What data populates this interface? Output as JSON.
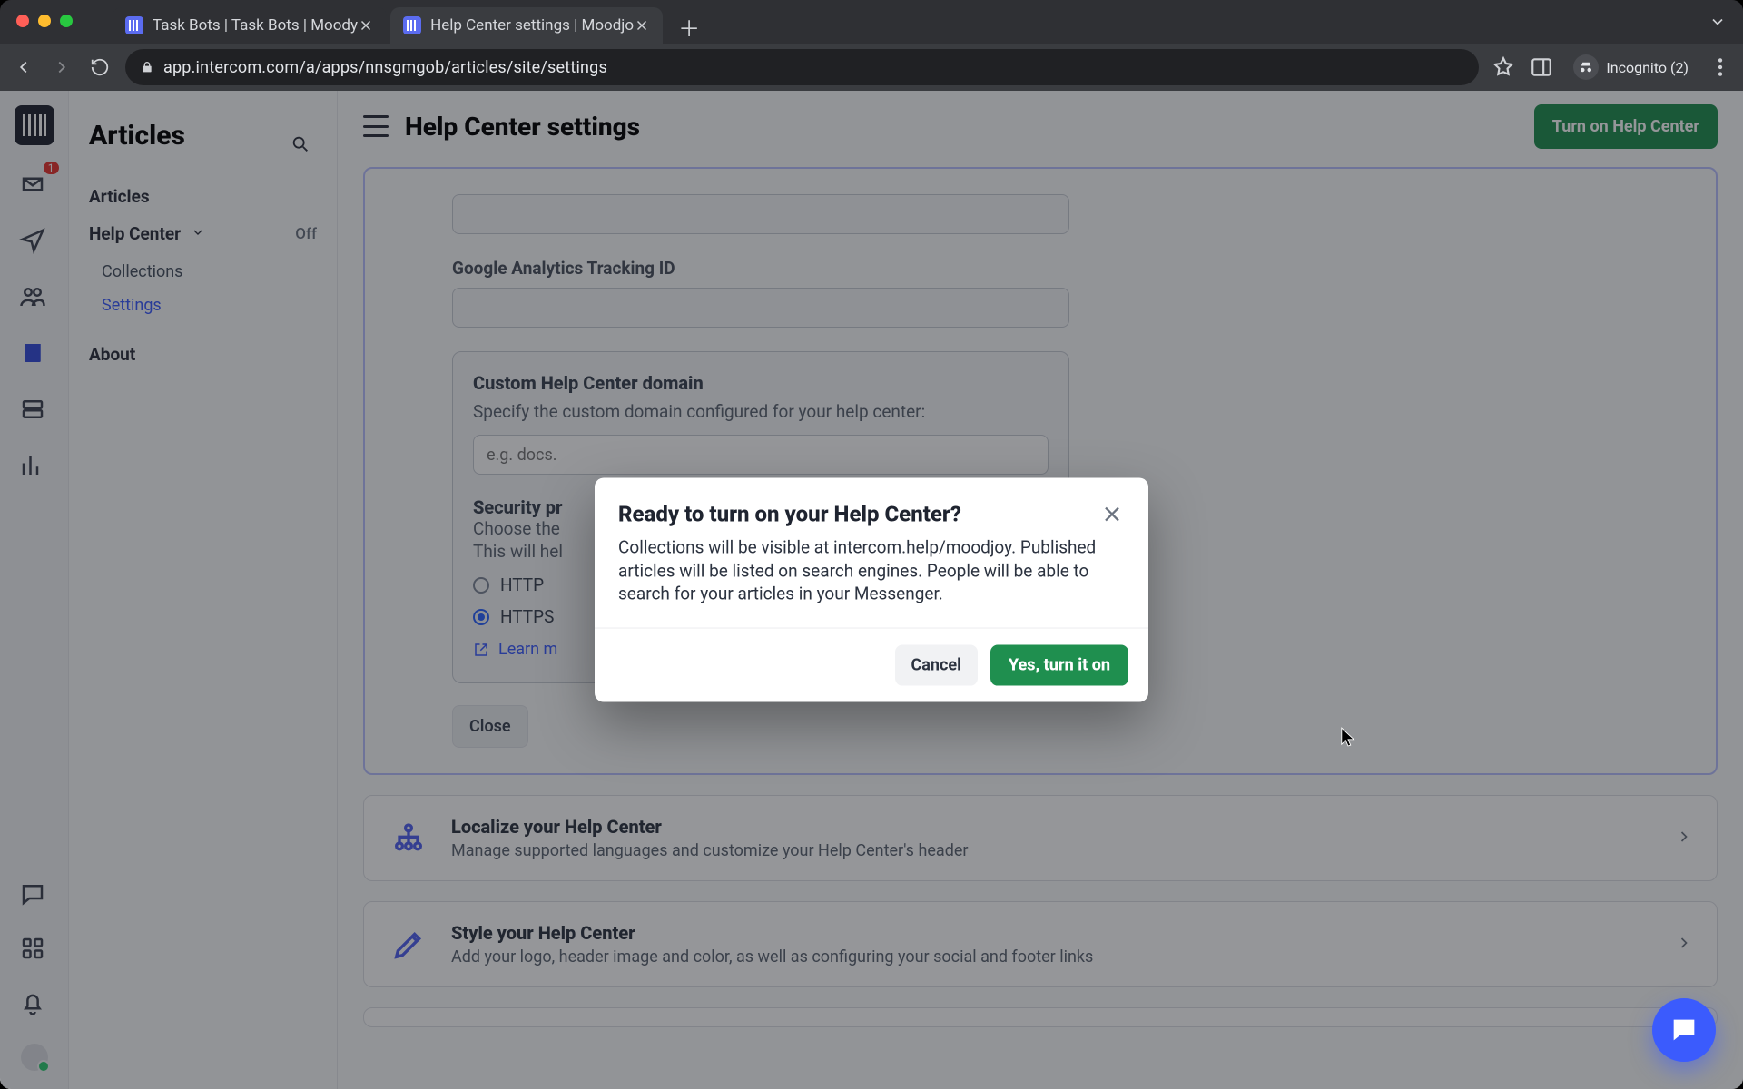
{
  "browser": {
    "tabs": [
      {
        "title": "Task Bots | Task Bots | Moody"
      },
      {
        "title": "Help Center settings | Moodjo"
      }
    ],
    "url": "app.intercom.com/a/apps/nnsgmgob/articles/site/settings",
    "incognito_label": "Incognito (2)"
  },
  "sidebar": {
    "title": "Articles",
    "items": {
      "articles": "Articles",
      "help_center": "Help Center",
      "help_center_status": "Off",
      "collections": "Collections",
      "settings": "Settings",
      "about": "About"
    }
  },
  "topbar": {
    "page_title": "Help Center settings",
    "turn_on": "Turn on Help Center"
  },
  "settings": {
    "ga_label": "Google Analytics Tracking ID",
    "domain_title": "Custom Help Center domain",
    "domain_desc": "Specify the custom domain configured for your help center:",
    "domain_placeholder": "e.g. docs.",
    "security_title": "Security pr",
    "security_desc_line1": "Choose the",
    "security_desc_line2": "This will hel",
    "radio_http": "HTTP",
    "radio_https": "HTTPS",
    "learn_more": "Learn m",
    "close": "Close"
  },
  "sections": {
    "localize": {
      "title": "Localize your Help Center",
      "sub": "Manage supported languages and customize your Help Center's header"
    },
    "style": {
      "title": "Style your Help Center",
      "sub": "Add your logo, header image and color, as well as configuring your social and footer links"
    }
  },
  "modal": {
    "title": "Ready to turn on your Help Center?",
    "body": "Collections will be visible at intercom.help/moodjoy. Published articles will be listed on search engines. People will be able to search for your articles in your Messenger.",
    "cancel": "Cancel",
    "confirm": "Yes, turn it on"
  },
  "rail": {
    "badge": "1"
  }
}
